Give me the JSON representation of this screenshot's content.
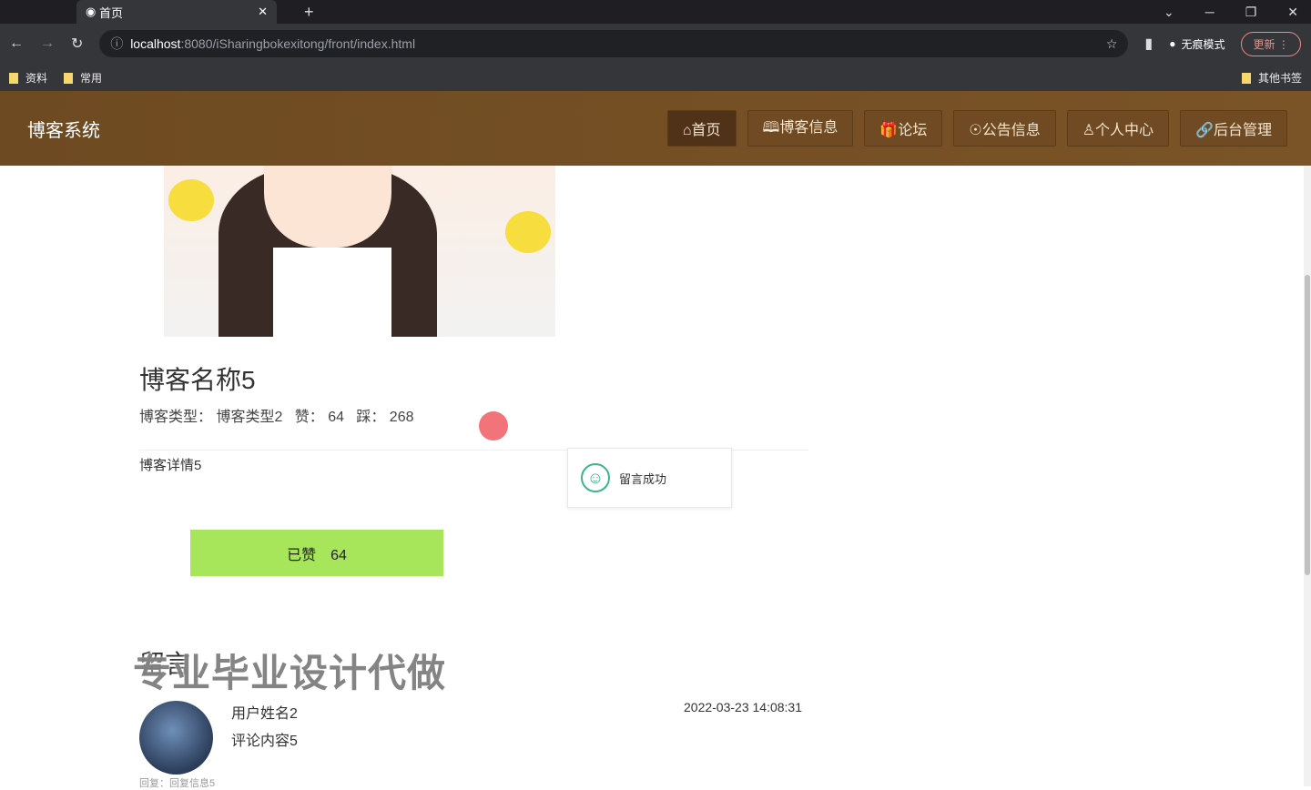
{
  "browser": {
    "tab_title": "首页",
    "url_host": "localhost",
    "url_rest": ":8080/iSharingbokexitong/front/index.html",
    "incognito": "无痕模式",
    "update": "更新",
    "bookmarks": [
      "资料",
      "常用"
    ],
    "other_bookmarks": "其他书签"
  },
  "nav": {
    "brand": "博客系统",
    "items": [
      "⌂首页",
      "🕮博客信息",
      "🎁论坛",
      "☉公告信息",
      "♙个人中心",
      "🔗后台管理"
    ]
  },
  "blog": {
    "title": "博客名称5",
    "type_label": "博客类型：",
    "type": "博客类型2",
    "like_label": "赞：",
    "likes": "64",
    "dislike_label": "踩：",
    "dislikes": "268",
    "detail": "博客详情5",
    "like_button": "已赞　64"
  },
  "toast": {
    "text": "留言成功"
  },
  "messages": {
    "heading": "留言",
    "watermark": "专业毕业设计代做",
    "items": [
      {
        "user": "用户姓名2",
        "content": "评论内容5",
        "time": "2022-03-23 14:08:31",
        "reply": "回复：回复信息5"
      }
    ]
  }
}
